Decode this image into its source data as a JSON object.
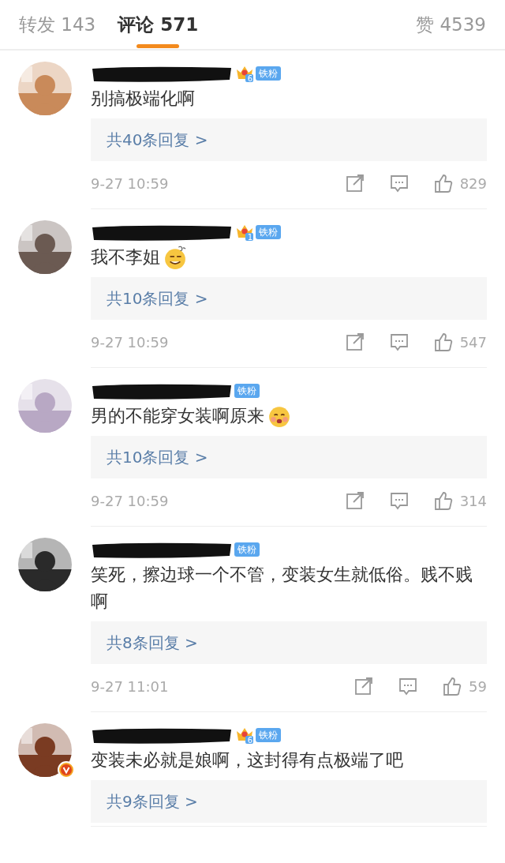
{
  "tabs": [
    {
      "label": "转发 143",
      "selected": false
    },
    {
      "label": "评论 571",
      "selected": true
    },
    {
      "label": "赞 4539",
      "selected": false
    }
  ],
  "comments": [
    {
      "name_redacted": true,
      "crown": true,
      "crown_level": "6",
      "fan_badge": "铁粉",
      "text": "别搞极端化啊",
      "replies": "共40条回复 >",
      "time": "9-27 10:59",
      "likes": "829",
      "verified": false
    },
    {
      "name_redacted": true,
      "crown": true,
      "crown_level": "1",
      "fan_badge": "铁粉",
      "text": "我不李姐",
      "emoji": {
        "kind": "confused"
      },
      "replies": "共10条回复 >",
      "time": "9-27 10:59",
      "likes": "547",
      "verified": false
    },
    {
      "name_redacted": true,
      "crown": false,
      "fan_badge": "铁粉",
      "text": "男的不能穿女装啊原来",
      "emoji": {
        "kind": "blush"
      },
      "replies": "共10条回复 >",
      "time": "9-27 10:59",
      "likes": "314",
      "verified": false
    },
    {
      "name_redacted": true,
      "crown": false,
      "fan_badge": "铁粉",
      "text": "笑死，擦边球一个不管，变装女生就低俗。贱不贱啊",
      "replies": "共8条回复 >",
      "time": "9-27 11:01",
      "likes": "59",
      "verified": false
    },
    {
      "name_redacted": true,
      "crown": true,
      "crown_level": "6",
      "fan_badge": "铁粉",
      "text": "变装未必就是娘啊，这封得有点极端了吧",
      "replies": "共9条回复 >",
      "verified": true
    }
  ]
}
